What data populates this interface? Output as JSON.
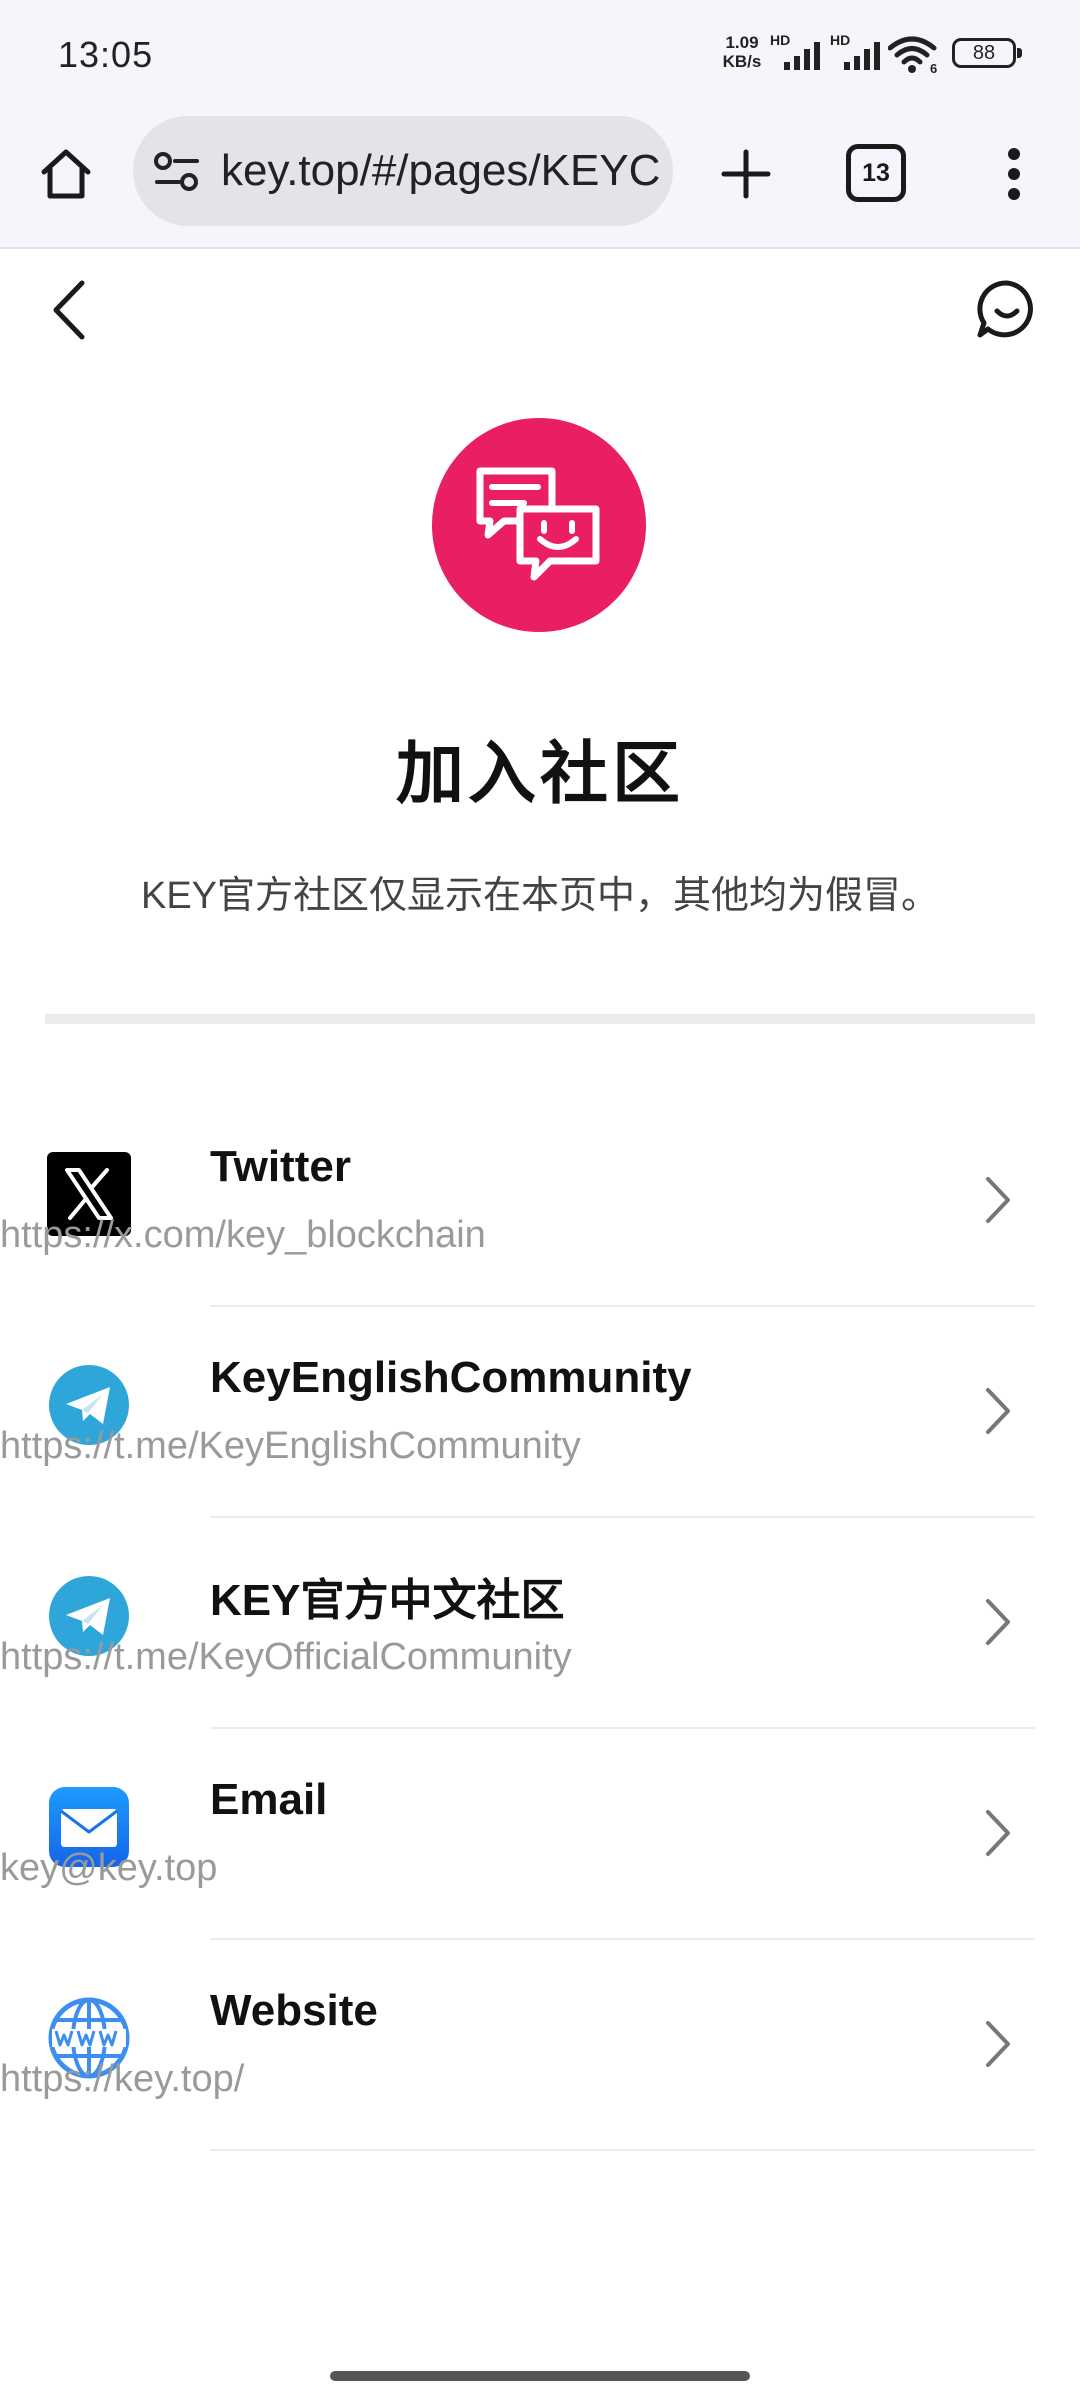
{
  "status_bar": {
    "time": "13:05",
    "net_speed_value": "1.09",
    "net_speed_unit": "KB/s",
    "signal_1_label": "HD",
    "signal_2_label": "HD",
    "wifi_label": "6",
    "battery": "88"
  },
  "browser": {
    "url": "key.top/#/pages/KEYC",
    "tab_count": "13"
  },
  "page": {
    "title": "加入社区",
    "subtitle": "KEY官方社区仅显示在本页中，其他均为假冒。"
  },
  "links": [
    {
      "title": "Twitter",
      "url": "https://x.com/key_blockchain",
      "icon": "x-logo-icon"
    },
    {
      "title": "KeyEnglishCommunity",
      "url": "https://t.me/KeyEnglishCommunity",
      "icon": "telegram-icon"
    },
    {
      "title": "KEY官方中文社区",
      "url": "https://t.me/KeyOfficialCommunity",
      "icon": "telegram-icon"
    },
    {
      "title": "Email",
      "url": "key@key.top",
      "icon": "email-icon"
    },
    {
      "title": "Website",
      "url": "https://key.top/",
      "icon": "globe-www-icon"
    }
  ],
  "colors": {
    "accent": "#e91e63",
    "telegram": "#2ea6da",
    "email": "#1a73e8",
    "web": "#3d8ef0"
  }
}
